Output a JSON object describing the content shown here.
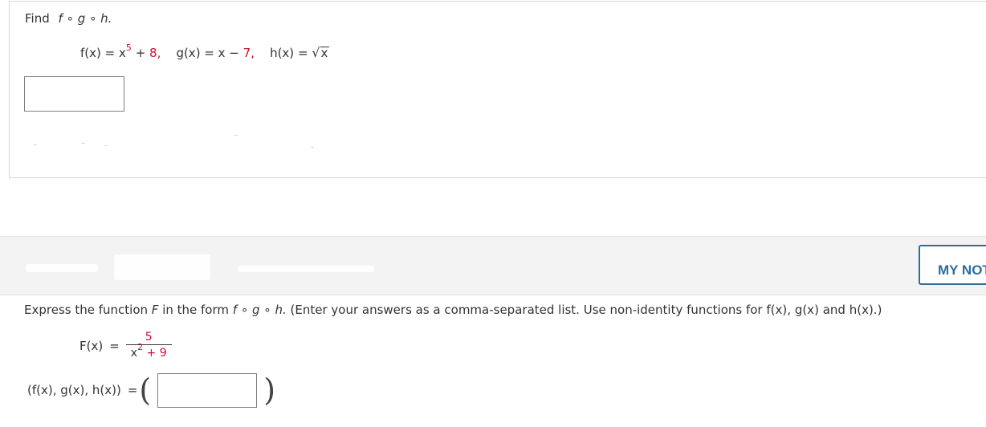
{
  "question1": {
    "instruction": "Find",
    "composition": "f ∘ g ∘ h.",
    "f_label": "f(x)",
    "f_eq": "=",
    "f_base": "x",
    "f_exp": "5",
    "f_plus": "+",
    "f_const": "8,",
    "g_label": "g(x)",
    "g_eq": "= x −",
    "g_const": "7,",
    "h_label": "h(x)",
    "h_eq": "=",
    "h_sqrt": "√",
    "h_arg": "x",
    "answer_value": ""
  },
  "question2": {
    "notes_button": "MY NOTES",
    "instruction_pre": "Express the function",
    "F": "F",
    "instruction_mid": "in the form",
    "composition": "f ∘ g ∘ h.",
    "instruction_post": "(Enter your answers as a comma-separated list. Use non-identity functions for",
    "fx": "f(x),",
    "gx": "g(x)",
    "and": "and",
    "hx": "h(x).)",
    "F_label": "F(x)",
    "F_eq": "=",
    "numerator": "5",
    "den_base": "x",
    "den_exp": "2",
    "den_rest": "+ 9",
    "tuple_label": "(f(x), g(x), h(x))",
    "tuple_eq": "=",
    "paren_open": "(",
    "paren_close": ")",
    "answer_value": ""
  },
  "colors": {
    "accent_red": "#c8102e",
    "button_blue": "#2b6e9b",
    "border_gray": "#d6d6d6",
    "header_bg": "#f3f3f3"
  }
}
